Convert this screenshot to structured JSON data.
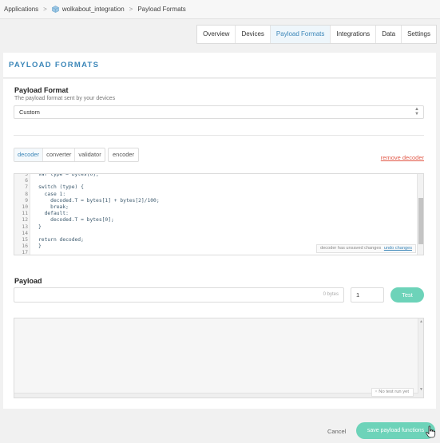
{
  "breadcrumb": {
    "root": "Applications",
    "app": "wolkabout_integration",
    "current": "Payload Formats"
  },
  "tabs": [
    {
      "label": "Overview",
      "active": false
    },
    {
      "label": "Devices",
      "active": false
    },
    {
      "label": "Payload Formats",
      "active": true
    },
    {
      "label": "Integrations",
      "active": false
    },
    {
      "label": "Data",
      "active": false
    },
    {
      "label": "Settings",
      "active": false
    }
  ],
  "card": {
    "title": "PAYLOAD FORMATS"
  },
  "payload_format": {
    "label": "Payload Format",
    "description": "The payload format sent by your devices",
    "selected": "Custom"
  },
  "function_tabs": [
    "decoder",
    "converter",
    "validator"
  ],
  "active_function": "decoder",
  "encoder_label": "encoder",
  "remove_label": "remove decoder",
  "editor": {
    "lines": [
      {
        "n": "5",
        "code": "var type = bytes[0];"
      },
      {
        "n": "6",
        "code": ""
      },
      {
        "n": "7",
        "code": "switch (type) {"
      },
      {
        "n": "8",
        "code": "  case 1:"
      },
      {
        "n": "9",
        "code": "    decoded.T = bytes[1] + bytes[2]/100;"
      },
      {
        "n": "10",
        "code": "    break;"
      },
      {
        "n": "11",
        "code": "  default:"
      },
      {
        "n": "12",
        "code": "    decoded.T = bytes[0];"
      },
      {
        "n": "13",
        "code": "}"
      },
      {
        "n": "14",
        "code": ""
      },
      {
        "n": "15",
        "code": "return decoded;"
      },
      {
        "n": "16",
        "code": "}"
      },
      {
        "n": "17",
        "code": ""
      }
    ],
    "status_text": "decoder has unsaved changes",
    "undo_label": "undo changes"
  },
  "payload": {
    "label": "Payload",
    "bytes_hint": "0 bytes",
    "port_value": "1",
    "test_label": "Test"
  },
  "output": {
    "status": "No test run yet"
  },
  "actions": {
    "cancel_label": "Cancel",
    "save_label": "save payload functions"
  },
  "colors": {
    "accent": "#3b86b8",
    "button": "#6dd3b9",
    "danger": "#e25b4a"
  }
}
